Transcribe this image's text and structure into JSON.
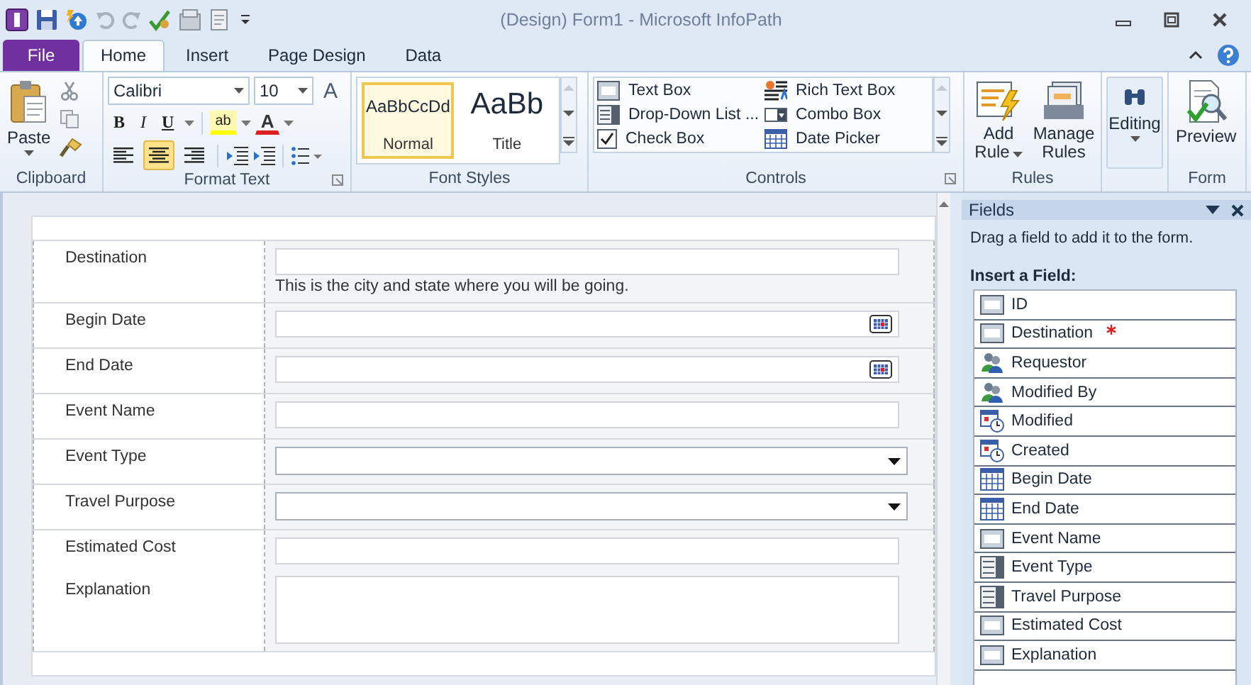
{
  "window": {
    "title": "(Design) Form1  -  Microsoft InfoPath"
  },
  "tabs": [
    {
      "label": "File",
      "kind": "file",
      "selected": false
    },
    {
      "label": "Home",
      "kind": "tab",
      "selected": true
    },
    {
      "label": "Insert",
      "kind": "tab",
      "selected": false
    },
    {
      "label": "Page Design",
      "kind": "tab",
      "selected": false
    },
    {
      "label": "Data",
      "kind": "tab",
      "selected": false
    }
  ],
  "ribbon": {
    "clipboard": {
      "paste": "Paste",
      "label": "Clipboard"
    },
    "format_text": {
      "font": "Calibri",
      "size": "10",
      "clear_glyph": "A",
      "highlight": "ab",
      "font_color": "A",
      "label": "Format Text",
      "styles": [
        {
          "text": "B",
          "kind": "bold"
        },
        {
          "text": "I",
          "kind": "italic"
        },
        {
          "text": "U",
          "kind": "underline"
        }
      ],
      "align": [
        {
          "kind": "left",
          "selected": false
        },
        {
          "kind": "center",
          "selected": true
        },
        {
          "kind": "right",
          "selected": false
        }
      ]
    },
    "font_styles": {
      "label": "Font Styles",
      "items": [
        {
          "preview": "AaBbCcDd",
          "name": "Normal",
          "kind": "normal",
          "selected": true
        },
        {
          "preview": "AaBb",
          "name": "Title",
          "kind": "title",
          "selected": false
        }
      ]
    },
    "controls": {
      "label": "Controls",
      "items": [
        {
          "label": "Text Box",
          "kind": "textbox"
        },
        {
          "label": "Rich Text Box",
          "kind": "richtext"
        },
        {
          "label": "Drop-Down List ...",
          "kind": "dropdown"
        },
        {
          "label": "Combo Box",
          "kind": "combo"
        },
        {
          "label": "Check Box",
          "kind": "checkbox"
        },
        {
          "label": "Date Picker",
          "kind": "datepicker"
        }
      ]
    },
    "rules": {
      "label": "Rules",
      "items": [
        {
          "label": "Add Rule",
          "kind": "add"
        },
        {
          "label": "Manage Rules",
          "kind": "manage"
        }
      ]
    },
    "editing": {
      "label": "Editing"
    },
    "form": {
      "label": "Form",
      "preview": "Preview"
    }
  },
  "form": {
    "sections": [
      {
        "rows": [
          {
            "label": "Destination",
            "kind": "text",
            "hint": "This is the city and state where you will be going."
          }
        ]
      },
      {
        "rows": [
          {
            "label": "Begin Date",
            "kind": "date"
          }
        ]
      },
      {
        "rows": [
          {
            "label": "End Date",
            "kind": "date"
          }
        ]
      },
      {
        "rows": [
          {
            "label": "Event Name",
            "kind": "text"
          }
        ]
      },
      {
        "rows": [
          {
            "label": "Event Type",
            "kind": "dropdown"
          }
        ]
      },
      {
        "rows": [
          {
            "label": "Travel Purpose",
            "kind": "dropdown"
          }
        ]
      },
      {
        "rows": [
          {
            "label": "Estimated Cost",
            "kind": "text"
          },
          {
            "label": "Explanation",
            "kind": "multiline"
          }
        ]
      }
    ]
  },
  "fields_pane": {
    "title": "Fields",
    "hint": "Drag a field to add it to the form.",
    "heading": "Insert a Field:",
    "items": [
      {
        "name": "ID",
        "kind": "text",
        "required": false
      },
      {
        "name": "Destination",
        "kind": "text",
        "required": true
      },
      {
        "name": "Requestor",
        "kind": "person",
        "required": false
      },
      {
        "name": "Modified By",
        "kind": "person",
        "required": false
      },
      {
        "name": "Modified",
        "kind": "datetime",
        "required": false
      },
      {
        "name": "Created",
        "kind": "datetime",
        "required": false
      },
      {
        "name": "Begin Date",
        "kind": "date",
        "required": false
      },
      {
        "name": "End Date",
        "kind": "date",
        "required": false
      },
      {
        "name": "Event Name",
        "kind": "text",
        "required": false
      },
      {
        "name": "Event Type",
        "kind": "list",
        "required": false
      },
      {
        "name": "Travel Purpose",
        "kind": "list",
        "required": false
      },
      {
        "name": "Estimated Cost",
        "kind": "text",
        "required": false
      },
      {
        "name": "Explanation",
        "kind": "text",
        "required": false
      }
    ]
  }
}
